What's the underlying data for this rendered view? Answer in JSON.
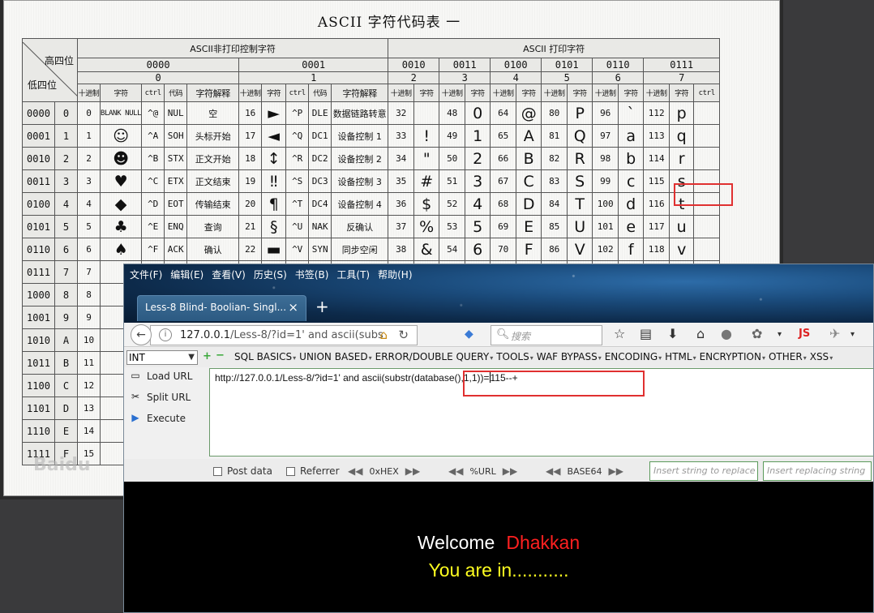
{
  "ascii": {
    "title": "ASCII 字符代码表 一",
    "corner_high": "高四位",
    "corner_low": "低四位",
    "group_ctrl": "ASCII非打印控制字符",
    "group_print": "ASCII 打印字符",
    "bits": [
      "0000",
      "0001",
      "0010",
      "0011",
      "0100",
      "0101",
      "0110",
      "0111"
    ],
    "digits": [
      "0",
      "1",
      "2",
      "3",
      "4",
      "5",
      "6",
      "7"
    ],
    "sub_headers": {
      "dec": "十进制",
      "char": "字符",
      "ctrl": "ctrl",
      "code": "代码",
      "desc": "字符解释"
    },
    "rows": [
      {
        "bin": "0000",
        "hex": "0",
        "c0": [
          "0",
          "BLANK NULL",
          "^@",
          "NUL",
          "空"
        ],
        "c1": [
          "16",
          "►",
          "^P",
          "DLE",
          "数据链路转意"
        ],
        "p": [
          [
            "32",
            ""
          ],
          [
            "48",
            "0"
          ],
          [
            "64",
            "@"
          ],
          [
            "80",
            "P"
          ],
          [
            "96",
            "`"
          ],
          [
            "112",
            "p"
          ]
        ]
      },
      {
        "bin": "0001",
        "hex": "1",
        "c0": [
          "1",
          "☺",
          "^A",
          "SOH",
          "头标开始"
        ],
        "c1": [
          "17",
          "◄",
          "^Q",
          "DC1",
          "设备控制 1"
        ],
        "p": [
          [
            "33",
            "!"
          ],
          [
            "49",
            "1"
          ],
          [
            "65",
            "A"
          ],
          [
            "81",
            "Q"
          ],
          [
            "97",
            "a"
          ],
          [
            "113",
            "q"
          ]
        ]
      },
      {
        "bin": "0010",
        "hex": "2",
        "c0": [
          "2",
          "☻",
          "^B",
          "STX",
          "正文开始"
        ],
        "c1": [
          "18",
          "↕",
          "^R",
          "DC2",
          "设备控制 2"
        ],
        "p": [
          [
            "34",
            "\""
          ],
          [
            "50",
            "2"
          ],
          [
            "66",
            "B"
          ],
          [
            "82",
            "R"
          ],
          [
            "98",
            "b"
          ],
          [
            "114",
            "r"
          ]
        ]
      },
      {
        "bin": "0011",
        "hex": "3",
        "c0": [
          "3",
          "♥",
          "^C",
          "ETX",
          "正文结束"
        ],
        "c1": [
          "19",
          "‼",
          "^S",
          "DC3",
          "设备控制 3"
        ],
        "p": [
          [
            "35",
            "#"
          ],
          [
            "51",
            "3"
          ],
          [
            "67",
            "C"
          ],
          [
            "83",
            "S"
          ],
          [
            "99",
            "c"
          ],
          [
            "115",
            "s"
          ]
        ]
      },
      {
        "bin": "0100",
        "hex": "4",
        "c0": [
          "4",
          "◆",
          "^D",
          "EOT",
          "传输结束"
        ],
        "c1": [
          "20",
          "¶",
          "^T",
          "DC4",
          "设备控制 4"
        ],
        "p": [
          [
            "36",
            "$"
          ],
          [
            "52",
            "4"
          ],
          [
            "68",
            "D"
          ],
          [
            "84",
            "T"
          ],
          [
            "100",
            "d"
          ],
          [
            "116",
            "t"
          ]
        ]
      },
      {
        "bin": "0101",
        "hex": "5",
        "c0": [
          "5",
          "♣",
          "^E",
          "ENQ",
          "查询"
        ],
        "c1": [
          "21",
          "§",
          "^U",
          "NAK",
          "反确认"
        ],
        "p": [
          [
            "37",
            "%"
          ],
          [
            "53",
            "5"
          ],
          [
            "69",
            "E"
          ],
          [
            "85",
            "U"
          ],
          [
            "101",
            "e"
          ],
          [
            "117",
            "u"
          ]
        ]
      },
      {
        "bin": "0110",
        "hex": "6",
        "c0": [
          "6",
          "♠",
          "^F",
          "ACK",
          "确认"
        ],
        "c1": [
          "22",
          "▬",
          "^V",
          "SYN",
          "同步空闲"
        ],
        "p": [
          [
            "38",
            "&"
          ],
          [
            "54",
            "6"
          ],
          [
            "70",
            "F"
          ],
          [
            "86",
            "V"
          ],
          [
            "102",
            "f"
          ],
          [
            "118",
            "v"
          ]
        ]
      },
      {
        "bin": "0111",
        "hex": "7",
        "c0": [
          "7",
          "",
          "",
          "",
          ""
        ],
        "c1": [
          "",
          "",
          "",
          "",
          ""
        ],
        "p": [
          [
            "",
            ""
          ],
          [
            "",
            ""
          ],
          [
            "",
            ""
          ],
          [
            "",
            ""
          ],
          [
            "",
            ""
          ],
          [
            "",
            ""
          ]
        ]
      },
      {
        "bin": "1000",
        "hex": "8",
        "c0": [
          "8",
          "",
          "",
          "",
          ""
        ],
        "c1": [
          "",
          "",
          "",
          "",
          ""
        ],
        "p": [
          [
            "",
            ""
          ],
          [
            "",
            ""
          ],
          [
            "",
            ""
          ],
          [
            "",
            ""
          ],
          [
            "",
            ""
          ],
          [
            "",
            ""
          ]
        ]
      },
      {
        "bin": "1001",
        "hex": "9",
        "c0": [
          "9",
          "",
          "",
          "",
          ""
        ],
        "c1": [
          "",
          "",
          "",
          "",
          ""
        ],
        "p": [
          [
            "",
            ""
          ],
          [
            "",
            ""
          ],
          [
            "",
            ""
          ],
          [
            "",
            ""
          ],
          [
            "",
            ""
          ],
          [
            "",
            ""
          ]
        ]
      },
      {
        "bin": "1010",
        "hex": "A",
        "c0": [
          "10",
          "",
          "",
          "",
          ""
        ],
        "c1": [
          "",
          "",
          "",
          "",
          ""
        ],
        "p": [
          [
            "",
            ""
          ],
          [
            "",
            ""
          ],
          [
            "",
            ""
          ],
          [
            "",
            ""
          ],
          [
            "",
            ""
          ],
          [
            "",
            ""
          ]
        ]
      },
      {
        "bin": "1011",
        "hex": "B",
        "c0": [
          "11",
          "",
          "",
          "",
          ""
        ],
        "c1": [
          "",
          "",
          "",
          "",
          ""
        ],
        "p": [
          [
            "",
            ""
          ],
          [
            "",
            ""
          ],
          [
            "",
            ""
          ],
          [
            "",
            ""
          ],
          [
            "",
            ""
          ],
          [
            "",
            ""
          ]
        ]
      },
      {
        "bin": "1100",
        "hex": "C",
        "c0": [
          "12",
          "",
          "",
          "",
          ""
        ],
        "c1": [
          "",
          "",
          "",
          "",
          ""
        ],
        "p": [
          [
            "",
            ""
          ],
          [
            "",
            ""
          ],
          [
            "",
            ""
          ],
          [
            "",
            ""
          ],
          [
            "",
            ""
          ],
          [
            "",
            ""
          ]
        ]
      },
      {
        "bin": "1101",
        "hex": "D",
        "c0": [
          "13",
          "",
          "",
          "",
          ""
        ],
        "c1": [
          "",
          "",
          "",
          "",
          ""
        ],
        "p": [
          [
            "",
            ""
          ],
          [
            "",
            ""
          ],
          [
            "",
            ""
          ],
          [
            "",
            ""
          ],
          [
            "",
            ""
          ],
          [
            "",
            ""
          ]
        ]
      },
      {
        "bin": "1110",
        "hex": "E",
        "c0": [
          "14",
          "",
          "",
          "",
          ""
        ],
        "c1": [
          "",
          "",
          "",
          "",
          ""
        ],
        "p": [
          [
            "",
            ""
          ],
          [
            "",
            ""
          ],
          [
            "",
            ""
          ],
          [
            "",
            ""
          ],
          [
            "",
            ""
          ],
          [
            "",
            ""
          ]
        ]
      },
      {
        "bin": "1111",
        "hex": "F",
        "c0": [
          "15",
          "",
          "",
          "",
          ""
        ],
        "c1": [
          "",
          "",
          "",
          "",
          ""
        ],
        "p": [
          [
            "",
            ""
          ],
          [
            "",
            ""
          ],
          [
            "",
            ""
          ],
          [
            "",
            ""
          ],
          [
            "",
            ""
          ],
          [
            "",
            ""
          ]
        ]
      }
    ],
    "watermark": "Baidu"
  },
  "browser": {
    "menu": [
      "文件(F)",
      "编辑(E)",
      "查看(V)",
      "历史(S)",
      "书签(B)",
      "工具(T)",
      "帮助(H)"
    ],
    "tab_title": "Less-8 Blind- Boolian- Singl...",
    "tab_close": "×",
    "new_tab": "+",
    "url_host": "127.0.0.1",
    "url_rest": "/Less-8/?id=1'  and  ascii(subs",
    "search_placeholder": "搜索",
    "hackbar": {
      "select_value": "INT",
      "menus": [
        "SQL BASICS",
        "UNION BASED",
        "ERROR/DOUBLE QUERY",
        "TOOLS",
        "WAF BYPASS",
        "ENCODING",
        "HTML",
        "ENCRYPTION",
        "OTHER",
        "XSS"
      ],
      "load_url": "Load URL",
      "split_url": "Split URL",
      "execute": "Execute",
      "query_prefix": "http://127.0.0.1/Less-8/?id=1'  and  ",
      "query_highlight": "ascii(substr(database(),1,1))=",
      "query_suffix": "115--+",
      "post_data": "Post data",
      "referrer": "Referrer",
      "hex": "0xHEX",
      "url_enc": "%URL",
      "base64": "BASE64",
      "replace_placeholder": "Insert string to replace",
      "replacing_placeholder": "Insert replacing string"
    },
    "page": {
      "welcome": "Welcome",
      "name": "Dhakkan",
      "status": "You are in..........."
    }
  }
}
